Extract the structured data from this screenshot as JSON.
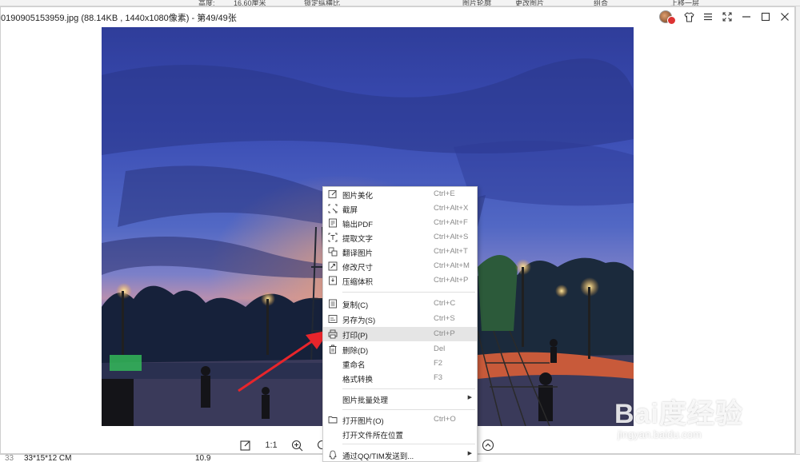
{
  "window": {
    "title": "0190905153959.jpg (88.14KB , 1440x1080像素) - 第49/49张",
    "buttons": [
      "skin",
      "menu",
      "fullscreen",
      "minimize",
      "maximize",
      "close"
    ]
  },
  "background_app": {
    "toolbar_fragments": [
      "高度:",
      "16.60厘米",
      "锁定纵横比",
      "图片轮廓",
      "更改图片",
      "组合",
      "上移一层"
    ],
    "bottom_fragments": [
      "33",
      "33*15*12 CM",
      "10.9"
    ]
  },
  "viewer_toolbar": {
    "actual_size_label": "1:1"
  },
  "context_menu": {
    "items": [
      {
        "label": "图片美化",
        "shortcut": "Ctrl+E",
        "icon": "edit-icon"
      },
      {
        "label": "截屏",
        "shortcut": "Ctrl+Alt+X",
        "icon": "screenshot-icon"
      },
      {
        "label": "输出PDF",
        "shortcut": "Ctrl+Alt+F",
        "icon": "pdf-icon"
      },
      {
        "label": "提取文字",
        "shortcut": "Ctrl+Alt+S",
        "icon": "text-extract-icon"
      },
      {
        "label": "翻译图片",
        "shortcut": "Ctrl+Alt+T",
        "icon": "translate-icon"
      },
      {
        "label": "修改尺寸",
        "shortcut": "Ctrl+Alt+M",
        "icon": "resize-icon"
      },
      {
        "label": "压缩体积",
        "shortcut": "Ctrl+Alt+P",
        "icon": "compress-icon"
      },
      {
        "label": "复制(C)",
        "shortcut": "Ctrl+C",
        "icon": "copy-icon"
      },
      {
        "label": "另存为(S)",
        "shortcut": "Ctrl+S",
        "icon": "save-as-icon"
      },
      {
        "label": "打印(P)",
        "shortcut": "Ctrl+P",
        "icon": "print-icon"
      },
      {
        "label": "删除(D)",
        "shortcut": "Del",
        "icon": "delete-icon"
      },
      {
        "label": "重命名",
        "shortcut": "F2",
        "icon": ""
      },
      {
        "label": "格式转换",
        "shortcut": "F3",
        "icon": ""
      },
      {
        "label": "图片批量处理",
        "shortcut": "",
        "icon": ""
      },
      {
        "label": "打开图片(O)",
        "shortcut": "Ctrl+O",
        "icon": "folder-icon"
      },
      {
        "label": "打开文件所在位置",
        "shortcut": "",
        "icon": ""
      },
      {
        "label": "通过QQ/TIM发送到...",
        "shortcut": "",
        "icon": "qq-icon"
      }
    ],
    "hovered_item": "打印(P)"
  },
  "watermark": {
    "main": "Bai度经验",
    "sub": "jingyan.baidu.com"
  },
  "colors": {
    "highlight": "#e5e5e5",
    "annotation": "#e8252b",
    "shortcut_text": "#8a8a8a"
  }
}
